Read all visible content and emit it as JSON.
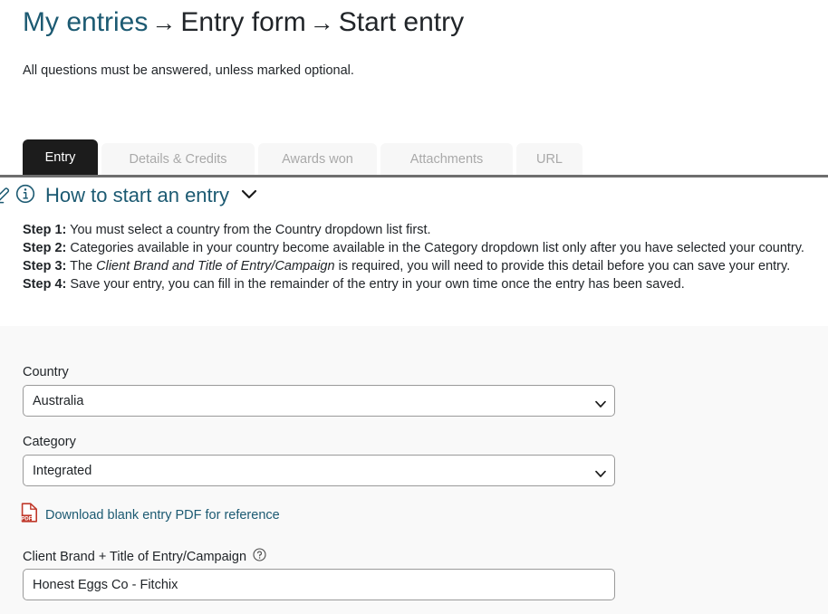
{
  "breadcrumb": {
    "item1": "My entries",
    "sep1": "→",
    "item2": "Entry form",
    "sep2": "→",
    "item3": "Start entry"
  },
  "intro": "All questions must be answered, unless marked optional.",
  "tabs": [
    {
      "label": "Entry",
      "active": true
    },
    {
      "label": "Details & Credits",
      "active": false
    },
    {
      "label": "Awards won",
      "active": false
    },
    {
      "label": "Attachments",
      "active": false
    },
    {
      "label": "URL",
      "active": false
    }
  ],
  "howto": {
    "title": "How to start an entry",
    "edit_icon": "pencil-icon",
    "info_icon": "info-circle-icon",
    "toggle_icon": "chevron-down-icon",
    "steps": [
      {
        "label": "Step 1:",
        "text": " You must select a country from the Country dropdown list first.",
        "emphasis": "",
        "text_after": ""
      },
      {
        "label": "Step 2:",
        "text": " Categories available in your country become available in the Category dropdown list only after you have selected your country.",
        "emphasis": "",
        "text_after": ""
      },
      {
        "label": "Step 3:",
        "text": " The ",
        "emphasis": "Client Brand and Title of Entry/Campaign",
        "text_after": " is required, you will need to provide this detail before you can save your entry."
      },
      {
        "label": "Step 4:",
        "text": " Save your entry, you can fill in the remainder of the entry in your own time once the entry has been saved.",
        "emphasis": "",
        "text_after": ""
      }
    ]
  },
  "form": {
    "country": {
      "label": "Country",
      "value": "Australia",
      "chevron_icon": "chevron-down-icon"
    },
    "category": {
      "label": "Category",
      "value": "Integrated",
      "chevron_icon": "chevron-down-icon"
    },
    "pdf": {
      "icon": "pdf-file-icon",
      "icon_text": "PDF",
      "link_text": "Download blank entry PDF for reference"
    },
    "client_brand": {
      "label": "Client Brand + Title of Entry/Campaign",
      "help_icon": "question-circle-icon",
      "value": "Honest Eggs Co - Fitchix",
      "placeholder": ""
    }
  },
  "colors": {
    "link": "#1c5a72",
    "text": "#212529",
    "active_tab_bg": "#1c1c1c",
    "inactive_tab_bg": "#f7f7f7",
    "inactive_tab_text": "#a9a9a9",
    "form_bg": "#f9f9f9",
    "border": "#9a9a9a",
    "rule": "#6e6e6e",
    "pdf_red": "#c0392b"
  }
}
